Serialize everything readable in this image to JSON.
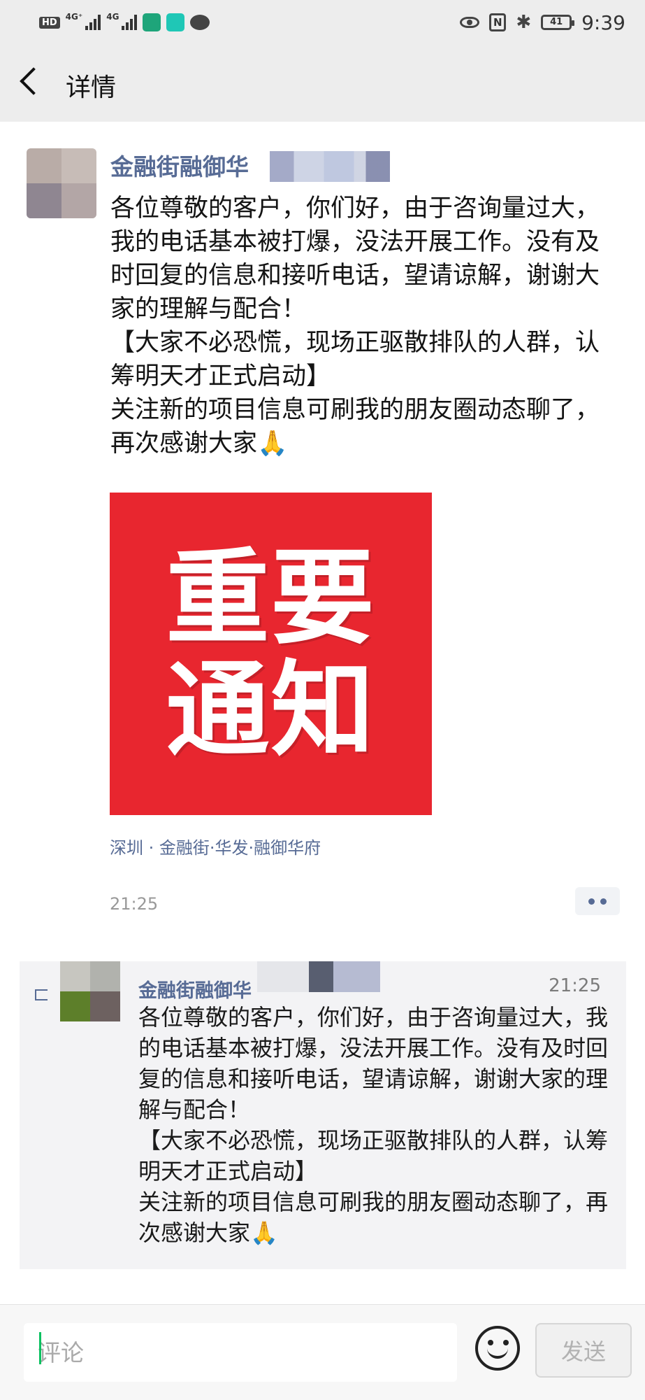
{
  "status_bar": {
    "left_badge": "HD",
    "net_1": "4G⁺",
    "net_2": "4G",
    "app_badge_label": "BOSS\n直聘",
    "battery": "41",
    "time": "9:39"
  },
  "header": {
    "title": "详情"
  },
  "post": {
    "author": "金融街融御华",
    "text": "各位尊敬的客户，你们好，由于咨询量过大，我的电话基本被打爆，没法开展工作。没有及时回复的信息和接听电话，望请谅解，谢谢大家的理解与配合！\n【大家不必恐慌，现场正驱散排队的人群，认筹明天才正式启动】\n关注新的项目信息可刷我的朋友圈动态聊了，再次感谢大家🙏",
    "image_text_line1": "重要",
    "image_text_line2": "通知",
    "image_color": "#e8262f",
    "location": "深圳 · 金融街·华发·融御华府",
    "time": "21:25"
  },
  "comment": {
    "author": "金融街融御华",
    "time": "21:25",
    "text": "各位尊敬的客户，你们好，由于咨询量过大，我的电话基本被打爆，没法开展工作。没有及时回复的信息和接听电话，望请谅解，谢谢大家的理解与配合！\n【大家不必恐慌，现场正驱散排队的人群，认筹明天才正式启动】\n关注新的项目信息可刷我的朋友圈动态聊了，再次感谢大家🙏"
  },
  "input_bar": {
    "placeholder": "评论",
    "send_label": "发送"
  },
  "colors": {
    "link": "#576b95",
    "bar_bg": "#ededed",
    "accent_green": "#08c160"
  }
}
